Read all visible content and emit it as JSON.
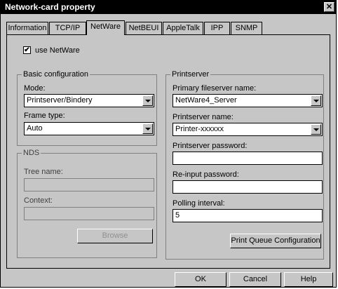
{
  "window": {
    "title": "Network-card property",
    "close_glyph": "✕"
  },
  "tabs": [
    "Information",
    "TCP/IP",
    "NetWare",
    "NetBEUI",
    "AppleTalk",
    "IPP",
    "SNMP"
  ],
  "active_tab": "NetWare",
  "use_netware": {
    "label": "use NetWare",
    "checked": true
  },
  "basic": {
    "title": "Basic configuration",
    "mode_label": "Mode:",
    "mode_value": "Printserver/Bindery",
    "frame_label": "Frame type:",
    "frame_value": "Auto"
  },
  "nds": {
    "title": "NDS",
    "tree_label": "Tree name:",
    "tree_value": "",
    "context_label": "Context:",
    "context_value": "",
    "browse_label": "Browse"
  },
  "printserver": {
    "title": "Printserver",
    "primary_label": "Primary fileserver name:",
    "primary_value": "NetWare4_Server",
    "name_label": "Printserver name:",
    "name_value": "Printer-xxxxxx",
    "password_label": "Printserver password:",
    "password_value": "",
    "reinput_label": "Re-input password:",
    "reinput_value": "",
    "polling_label": "Polling interval:",
    "polling_value": "5",
    "queue_button": "Print Queue Configuration"
  },
  "footer": {
    "ok": "OK",
    "cancel": "Cancel",
    "help": "Help"
  }
}
